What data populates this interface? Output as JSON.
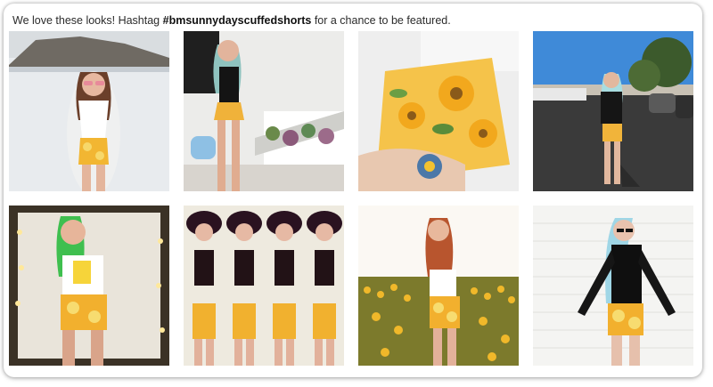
{
  "caption": {
    "prefix": "We love these looks! Hashtag ",
    "hashtag": "#bmsunnydayscuffedshorts",
    "suffix": " for a chance to be featured."
  },
  "photos": [
    {
      "subject": "beach-look",
      "icon": "photo"
    },
    {
      "subject": "wall-look",
      "icon": "photo"
    },
    {
      "subject": "shorts-closeup",
      "icon": "photo"
    },
    {
      "subject": "street-look",
      "icon": "photo"
    },
    {
      "subject": "bart-tee-look",
      "icon": "photo"
    },
    {
      "subject": "mirror-collage-look",
      "icon": "photo"
    },
    {
      "subject": "sunflower-field-look",
      "icon": "photo"
    },
    {
      "subject": "brick-wall-look",
      "icon": "photo"
    }
  ]
}
